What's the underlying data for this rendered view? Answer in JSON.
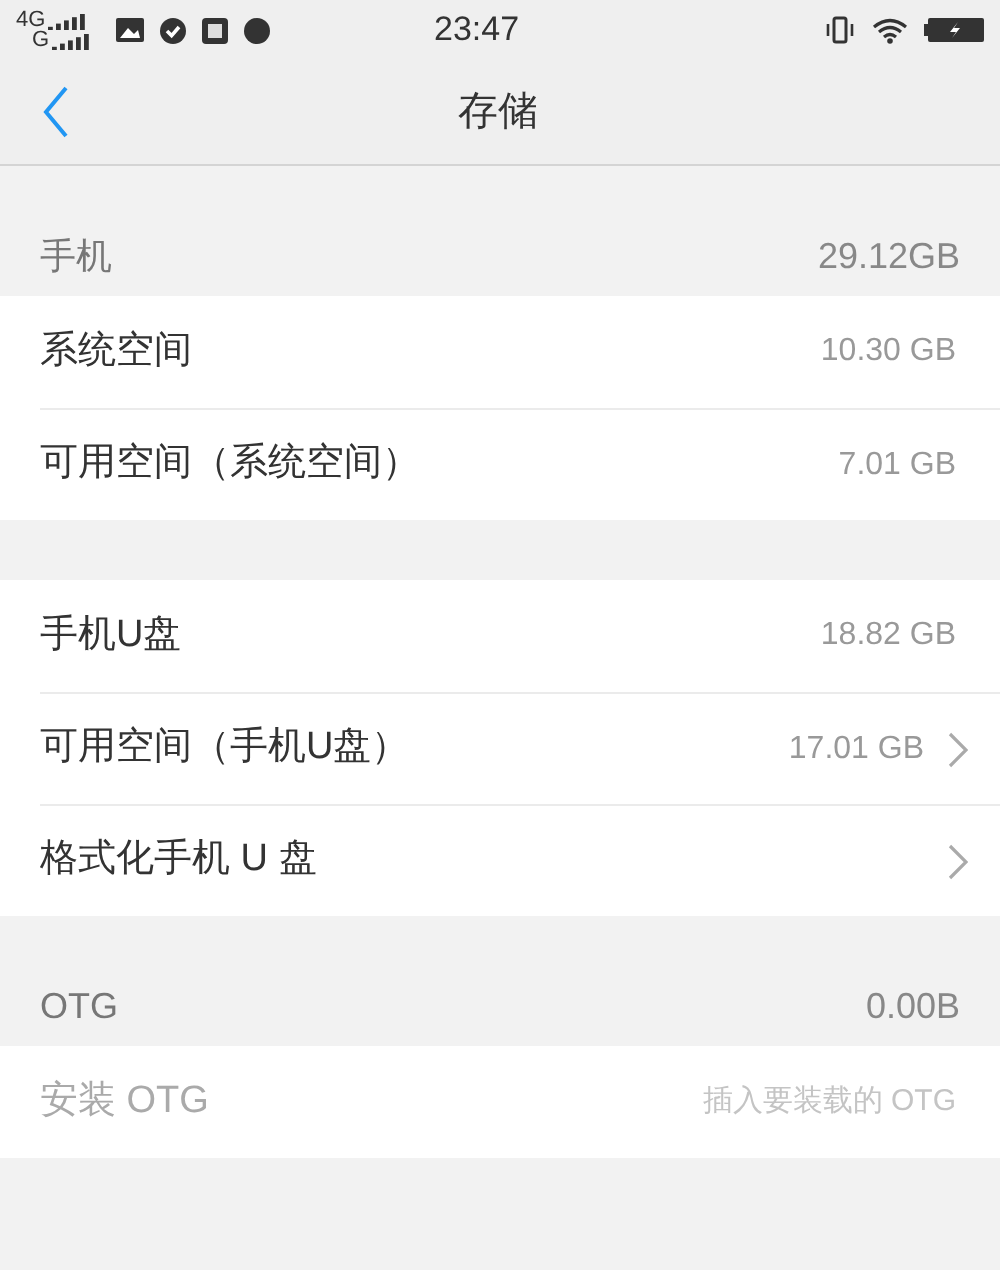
{
  "status_bar": {
    "network_top": "4G",
    "network_bottom": "G",
    "time": "23:47"
  },
  "nav": {
    "title": "存储"
  },
  "sections": [
    {
      "header": {
        "label": "手机",
        "value": "29.12GB"
      },
      "rows": [
        {
          "label": "系统空间",
          "value": "10.30 GB",
          "chevron": false,
          "disabled": false
        },
        {
          "label": "可用空间（系统空间）",
          "value": "7.01 GB",
          "chevron": false,
          "disabled": false
        }
      ]
    },
    {
      "rows": [
        {
          "label": "手机U盘",
          "value": "18.82 GB",
          "chevron": false,
          "disabled": false
        },
        {
          "label": "可用空间（手机U盘）",
          "value": "17.01 GB",
          "chevron": true,
          "disabled": false
        },
        {
          "label": "格式化手机 U 盘",
          "chevron": true,
          "disabled": false
        }
      ]
    },
    {
      "header": {
        "label": "OTG",
        "value": "0.00B"
      },
      "rows": [
        {
          "label": "安装 OTG",
          "value": "插入要装载的 OTG",
          "chevron": false,
          "disabled": true
        }
      ]
    }
  ]
}
